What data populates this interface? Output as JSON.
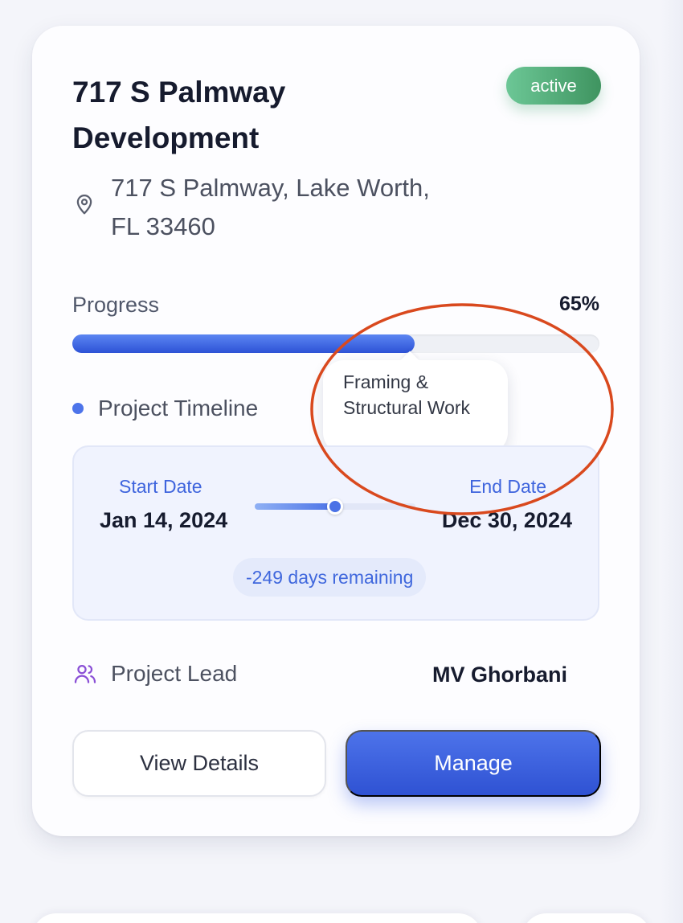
{
  "card": {
    "title": "717 S Palmway Development",
    "status": "active",
    "address": "717 S Palmway, Lake Worth, FL 33460",
    "progress": {
      "label": "Progress",
      "percent_text": "65%",
      "value": 0.65,
      "tooltip": "Framing & Structural Work"
    },
    "timeline": {
      "label": "Project Timeline",
      "start_label": "Start Date",
      "start_date": "Jan 14, 2024",
      "end_label": "End Date",
      "end_date": "Dec 30, 2024",
      "slider_value": 0.5,
      "remaining": "-249 days remaining"
    },
    "lead": {
      "label": "Project Lead",
      "name": "MV Ghorbani"
    },
    "buttons": {
      "details": "View Details",
      "manage": "Manage"
    }
  },
  "icons": {
    "location": "map-pin-icon",
    "lead": "users-icon"
  },
  "colors": {
    "accent": "#3e64dd",
    "status_active": "#52a673",
    "highlight": "#d9491e"
  }
}
